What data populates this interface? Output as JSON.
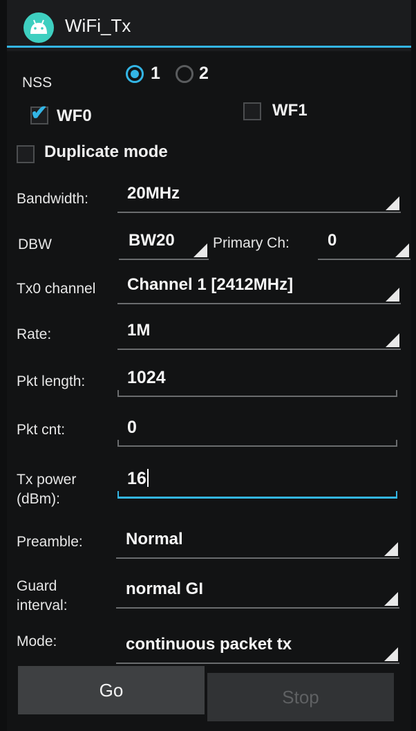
{
  "app": {
    "title": "WiFi_Tx",
    "icon": "android-icon"
  },
  "colors": {
    "accent": "#33b5e5",
    "background": "#121314"
  },
  "nss": {
    "label": "NSS",
    "options": [
      {
        "label": "1",
        "selected": true
      },
      {
        "label": "2",
        "selected": false
      }
    ]
  },
  "wf0": {
    "label": "WF0",
    "checked": true
  },
  "wf1": {
    "label": "WF1",
    "checked": false
  },
  "duplicate": {
    "label": "Duplicate mode",
    "checked": false
  },
  "bandwidth": {
    "label": "Bandwidth:",
    "value": "20MHz"
  },
  "dbw": {
    "label": "DBW",
    "value": "BW20"
  },
  "primary_ch": {
    "label": "Primary Ch:",
    "value": "0"
  },
  "tx0_channel": {
    "label": "Tx0 channel",
    "value": "Channel 1 [2412MHz]"
  },
  "rate": {
    "label": "Rate:",
    "value": "1M"
  },
  "pkt_length": {
    "label": "Pkt length:",
    "value": "1024"
  },
  "pkt_cnt": {
    "label": "Pkt cnt:",
    "value": "0"
  },
  "tx_power": {
    "label_line1": "Tx power",
    "label_line2": "(dBm):",
    "value": "16"
  },
  "preamble": {
    "label": "Preamble:",
    "value": "Normal"
  },
  "guard_interval": {
    "label_line1": "Guard",
    "label_line2": "interval:",
    "value": "normal GI"
  },
  "mode": {
    "label": "Mode:",
    "value": "continuous packet tx"
  },
  "buttons": {
    "go": "Go",
    "stop": "Stop"
  }
}
